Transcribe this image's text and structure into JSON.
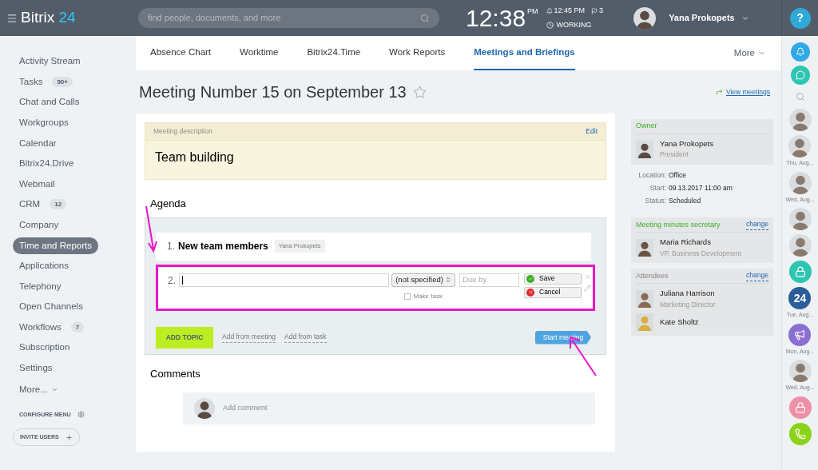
{
  "header": {
    "logo_text": "Bitrix",
    "logo_number": "24",
    "search": {
      "placeholder": "find people, documents, and more"
    },
    "time": "12:38",
    "time_suffix": "PM",
    "next_event": "12:45 PM",
    "flags": "3",
    "status": "WORKING",
    "user": "Yana Prokopets",
    "help": "?"
  },
  "sidebar": {
    "items": [
      {
        "label": "Activity Stream",
        "selected": false
      },
      {
        "label": "Tasks",
        "badge": "50+",
        "selected": false
      },
      {
        "label": "Chat and Calls",
        "selected": false
      },
      {
        "label": "Workgroups",
        "selected": false
      },
      {
        "label": "Calendar",
        "selected": false
      },
      {
        "label": "Bitrix24.Drive",
        "selected": false
      },
      {
        "label": "Webmail",
        "selected": false
      },
      {
        "label": "CRM",
        "badge": "12",
        "selected": false
      },
      {
        "label": "Company",
        "selected": false
      },
      {
        "label": "Time and Reports",
        "selected": true
      },
      {
        "label": "Applications",
        "selected": false
      },
      {
        "label": "Telephony",
        "selected": false
      },
      {
        "label": "Open Channels",
        "selected": false
      },
      {
        "label": "Workflows",
        "badge": "7",
        "selected": false
      },
      {
        "label": "Subscription",
        "selected": false
      },
      {
        "label": "Settings",
        "selected": false
      }
    ],
    "more": "More...",
    "configure": "CONFIGURE MENU",
    "invite": "INVITE USERS"
  },
  "tabs": [
    {
      "label": "Absence Chart",
      "selected": false
    },
    {
      "label": "Worktime",
      "selected": false
    },
    {
      "label": "Bitrix24.Time",
      "selected": false
    },
    {
      "label": "Work Reports",
      "selected": false
    },
    {
      "label": "Meetings and Briefings",
      "selected": true
    }
  ],
  "tabs_more": "More",
  "page_title": "Meeting Number 15 on September 13",
  "view_meetings": "View meetings",
  "description": {
    "label": "Meeting description",
    "edit": "Edit",
    "text": "Team building"
  },
  "agenda": {
    "heading": "Agenda",
    "items": [
      {
        "number": "1.",
        "title": "New team members",
        "tag": "Yana Prokopets"
      }
    ],
    "editor": {
      "number": "2.",
      "select": "(not specified)",
      "due_placeholder": "Due by",
      "make_task": {
        "label": "Make task",
        "checked": false
      },
      "save": "Save",
      "cancel": "Cancel"
    },
    "add_topic": "ADD TOPIC",
    "add_from_meeting": "Add from meeting",
    "add_from_task": "Add from task",
    "start": "Start meeting"
  },
  "comments": {
    "heading": "Comments",
    "placeholder": "Add comment"
  },
  "info": {
    "owner": {
      "heading": "Owner",
      "name": "Yana Prokopets",
      "role": "President"
    },
    "details": [
      {
        "label": "Location:",
        "value": "Office"
      },
      {
        "label": "Start:",
        "value": "09.13.2017 11:00 am"
      },
      {
        "label": "Status:",
        "value": "Scheduled"
      }
    ],
    "secretary": {
      "heading": "Meeting minutes secretary",
      "change": "change",
      "name": "Maria Richards",
      "role": "VP, Business Development"
    },
    "attendees": {
      "heading": "Attendees",
      "change": "change",
      "people": [
        {
          "name": "Juliana Harrison",
          "role": "Marketing Director"
        },
        {
          "name": "Kate Sholtz"
        }
      ]
    }
  },
  "rail": [
    {
      "kind": "avatar"
    },
    {
      "kind": "avatar",
      "label": "Thu, Aug..."
    },
    {
      "kind": "avatar",
      "label": "Wed, Aug..."
    },
    {
      "kind": "avatar"
    },
    {
      "kind": "avatar"
    },
    {
      "kind": "lock",
      "color": "#2fc6b1"
    },
    {
      "kind": "number",
      "text": "24",
      "color": "#2a5d9a",
      "label": "Tue, Aug..."
    },
    {
      "kind": "megaphone",
      "color": "#8a6fd0",
      "label": "Mon, Aug..."
    },
    {
      "kind": "avatar",
      "label": "Wed, Aug..."
    },
    {
      "kind": "lock",
      "color": "#ee8fa8"
    },
    {
      "kind": "phone",
      "color": "#8bd219"
    }
  ]
}
